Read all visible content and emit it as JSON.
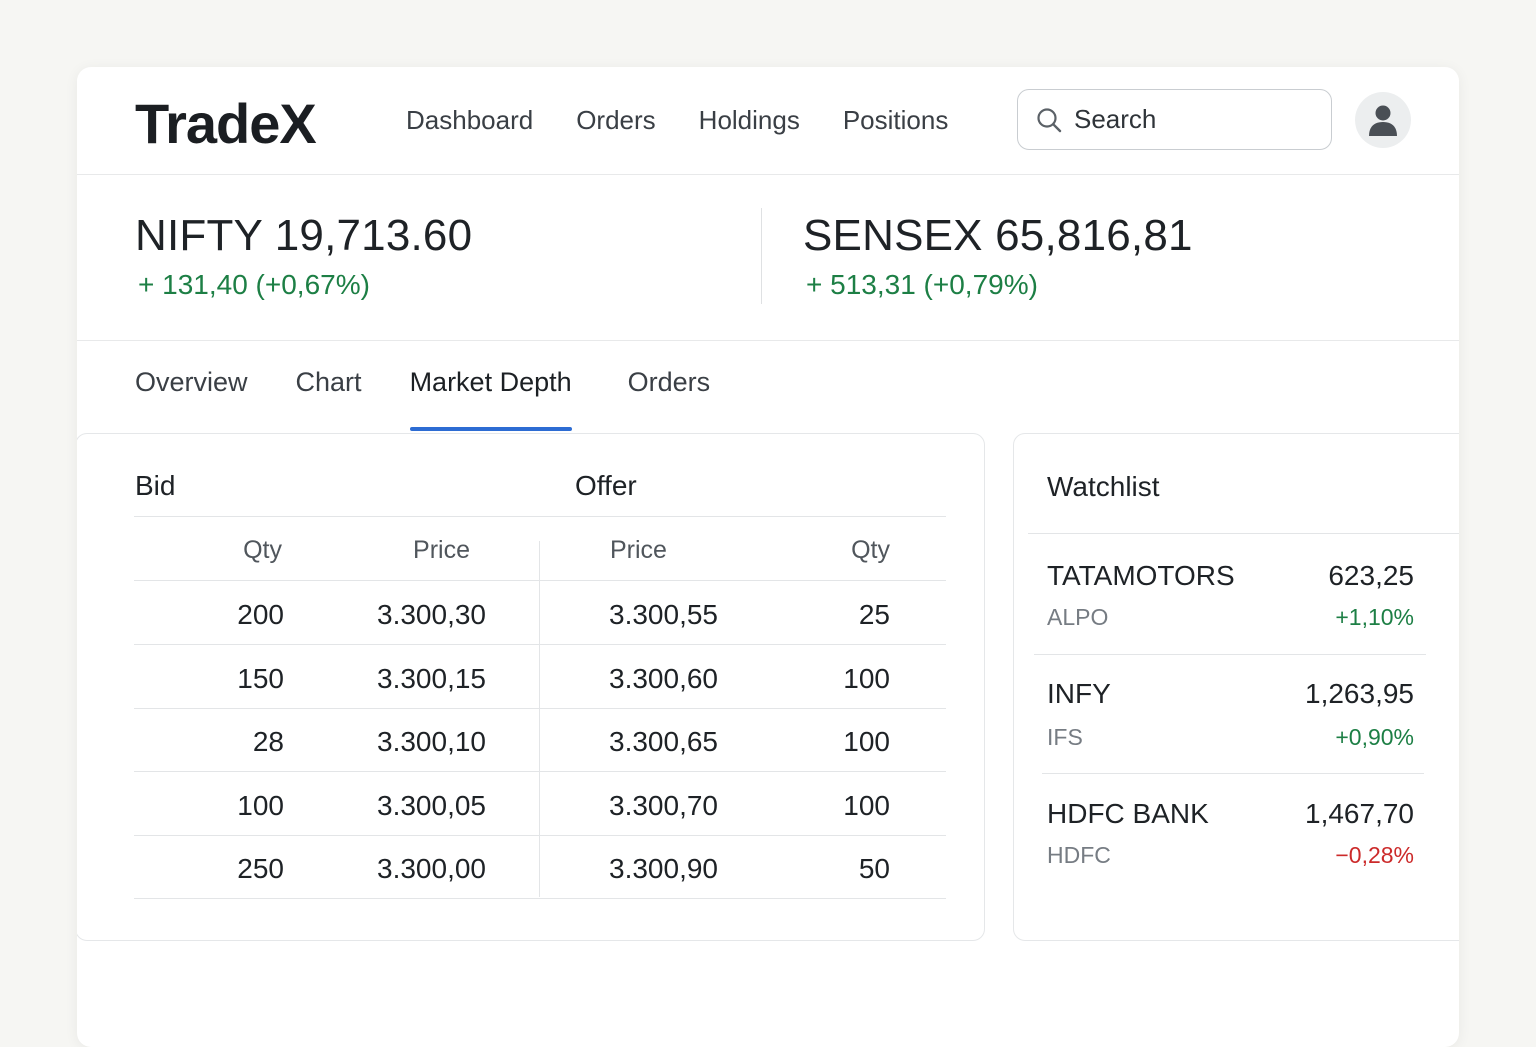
{
  "header": {
    "logo": "TradeX",
    "nav": [
      "Dashboard",
      "Orders",
      "Holdings",
      "Positions"
    ],
    "search_placeholder": "Search"
  },
  "indices": [
    {
      "name": "NIFTY 19,713.60",
      "change": "+ 131,40 (+0,67%)"
    },
    {
      "name": "SENSEX 65,816,81",
      "change": "+ 513,31 (+0,79%)"
    }
  ],
  "tabs": [
    "Overview",
    "Chart",
    "Market Depth",
    "Orders"
  ],
  "active_tab": "Market Depth",
  "depth": {
    "bid_title": "Bid",
    "offer_title": "Offer",
    "columns": [
      "Qty",
      "Price",
      "Price",
      "Qty"
    ],
    "rows": [
      [
        "200",
        "3.300,30",
        "3.300,55",
        "25"
      ],
      [
        "150",
        "3.300,15",
        "3.300,60",
        "100"
      ],
      [
        "28",
        "3.300,10",
        "3.300,65",
        "100"
      ],
      [
        "100",
        "3.300,05",
        "3.300,70",
        "100"
      ],
      [
        "250",
        "3.300,00",
        "3.300,90",
        "50"
      ]
    ]
  },
  "watchlist": {
    "title": "Watchlist",
    "items": [
      {
        "symbol": "TATAMOTORS",
        "sub": "ALPO",
        "price": "623,25",
        "change": "+1,10%",
        "direction": "up"
      },
      {
        "symbol": "INFY",
        "sub": "IFS",
        "price": "1,263,95",
        "change": "+0,90%",
        "direction": "up"
      },
      {
        "symbol": "HDFC BANK",
        "sub": "HDFC",
        "price": "1,467,70",
        "change": "−0,28%",
        "direction": "down"
      }
    ]
  },
  "colors": {
    "positive": "#1d7f45",
    "negative": "#cc2a2a",
    "accent": "#2d6cd3"
  },
  "icons": {
    "search": "search-icon",
    "avatar": "user-icon"
  }
}
